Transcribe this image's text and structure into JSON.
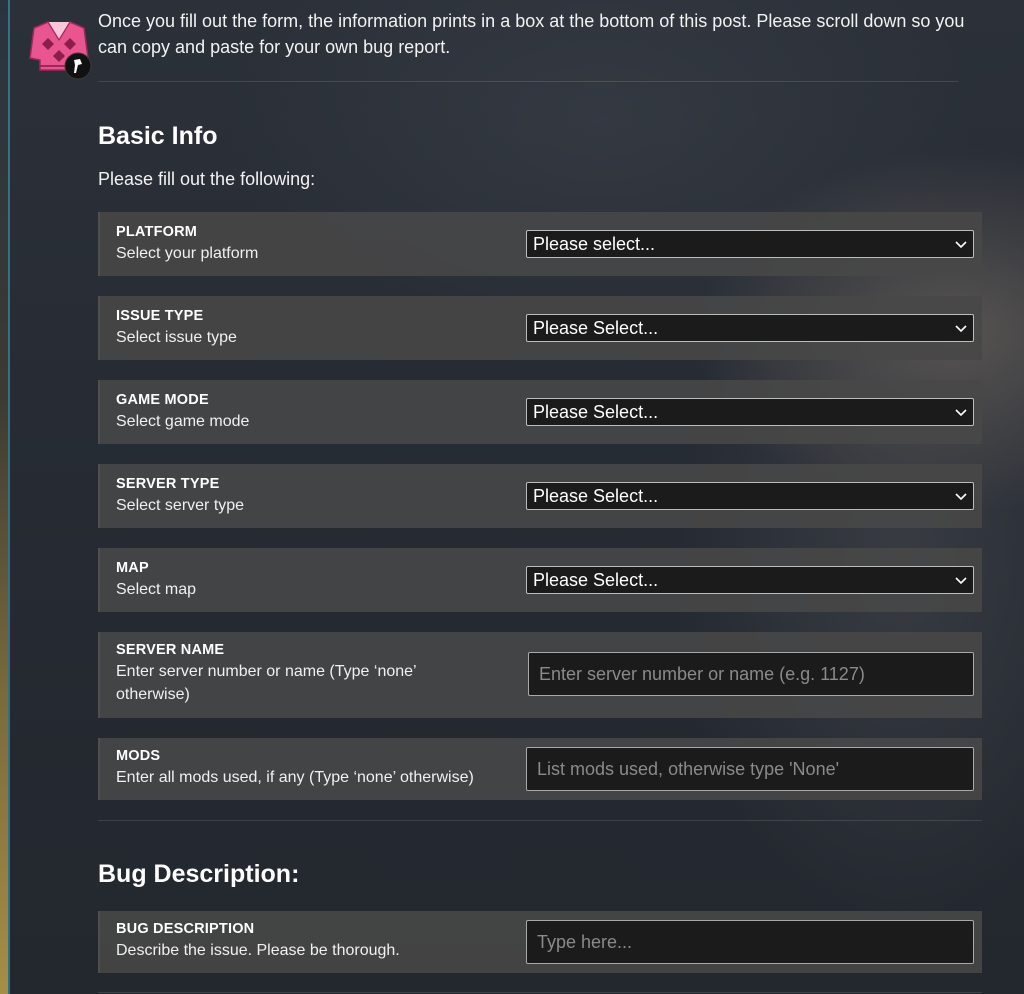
{
  "intro_text": "Once you fill out the form, the information prints in a box at the bottom of this post. Please scroll down so you can copy and paste for your own bug report.",
  "basic_info": {
    "heading": "Basic Info",
    "subheading": "Please fill out the following:",
    "fields": [
      {
        "title": "PLATFORM",
        "desc": "Select your platform",
        "value": "Please select..."
      },
      {
        "title": "ISSUE TYPE",
        "desc": "Select issue type",
        "value": "Please Select..."
      },
      {
        "title": "GAME MODE",
        "desc": "Select game mode",
        "value": "Please Select..."
      },
      {
        "title": "SERVER TYPE",
        "desc": "Select server type",
        "value": "Please Select..."
      },
      {
        "title": "MAP",
        "desc": "Select map",
        "value": "Please Select..."
      },
      {
        "title": "SERVER NAME",
        "desc": "Enter server number or name (Type ‘none’ otherwise)",
        "placeholder": "Enter server number or name (e.g. 1127)"
      },
      {
        "title": "MODS",
        "desc": "Enter all mods used, if any (Type ‘none’ otherwise)",
        "placeholder": "List mods used, otherwise type 'None'"
      }
    ]
  },
  "bug_description": {
    "heading": "Bug Description:",
    "field": {
      "title": "BUG DESCRIPTION",
      "desc": "Describe the issue. Please be thorough.",
      "placeholder": "Type here..."
    }
  },
  "colors": {
    "panel": "#484848",
    "input_bg": "#1b1b1b",
    "avatar_pink": "#e8558f"
  },
  "icons": {
    "avatar": "argyle-sweater-avatar",
    "badge": "torch-badge-icon",
    "dropdown": "chevron-down-icon"
  }
}
